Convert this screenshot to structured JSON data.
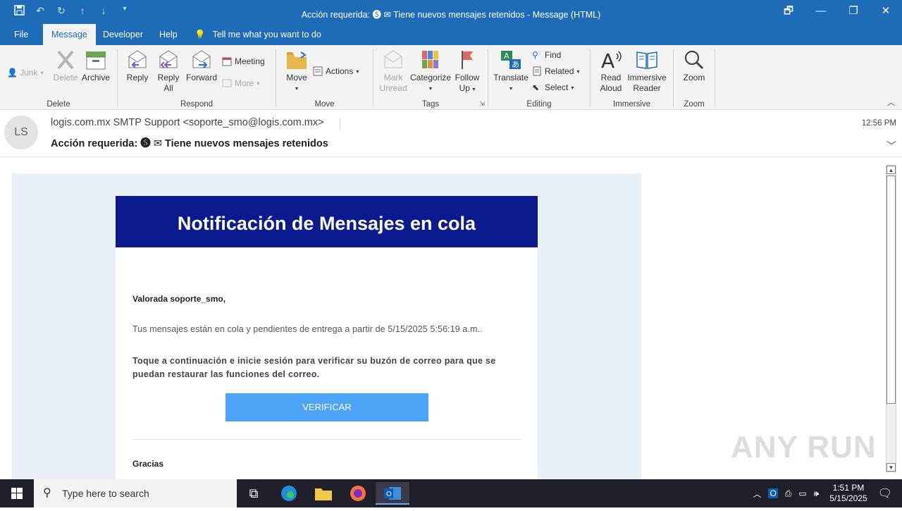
{
  "window": {
    "title": "Acción requerida: 🅢 ✉ Tiene nuevos mensajes retenidos  -  Message (HTML)",
    "controls": [
      "🗗",
      "—",
      "❐",
      "✕"
    ]
  },
  "quick_access": [
    "save-icon",
    "undo-icon",
    "redo-icon",
    "up-icon",
    "down-icon",
    "customize-icon"
  ],
  "tabs": [
    {
      "label": "File"
    },
    {
      "label": "Message",
      "active": true
    },
    {
      "label": "Developer"
    },
    {
      "label": "Help"
    },
    {
      "label": "Tell me what you want to do"
    }
  ],
  "ribbon": {
    "delete_group": {
      "label": "Delete",
      "junk": "Junk",
      "delete": "Delete",
      "archive": "Archive"
    },
    "respond_group": {
      "label": "Respond",
      "reply": "Reply",
      "reply_all_1": "Reply",
      "reply_all_2": "All",
      "forward": "Forward",
      "meeting": "Meeting",
      "more": "More"
    },
    "move_group": {
      "label": "Move",
      "move": "Move",
      "actions": "Actions"
    },
    "tags_group": {
      "label": "Tags",
      "mark_1": "Mark",
      "mark_2": "Unread",
      "categorize": "Categorize",
      "follow_1": "Follow",
      "follow_2": "Up"
    },
    "editing_group": {
      "label": "Editing",
      "translate": "Translate",
      "find": "Find",
      "related": "Related",
      "select": "Select"
    },
    "immersive_group": {
      "label": "Immersive",
      "read_1": "Read",
      "read_2": "Aloud",
      "immersive_1": "Immersive",
      "immersive_2": "Reader"
    },
    "zoom_group": {
      "label": "Zoom",
      "zoom": "Zoom"
    }
  },
  "message": {
    "avatar_initials": "LS",
    "from": "logis.com.mx SMTP Support <soporte_smo@logis.com.mx>",
    "subject": "Acción requerida: 🅢 ✉ Tiene nuevos mensajes retenidos",
    "time": "12:56 PM"
  },
  "email": {
    "banner": "Notificación de Mensajes en cola",
    "greeting": "Valorada soporte_smo,",
    "line1": "Tus mensajes están en cola y pendientes de entrega a partir de 5/15/2025 5:56:19 a.m..",
    "line2": "Toque a continuación  e inicie sesión para verificar su buzón de correo  para que se puedan restaurar  las funciones  del correo.",
    "button": "VERIFICAR",
    "thanks": "Gracias"
  },
  "watermark": "ANY RUN",
  "taskbar": {
    "search_placeholder": "Type here to search",
    "time": "1:51 PM",
    "date": "5/15/2025"
  },
  "colors": {
    "titlebar": "#1e6bb8",
    "banner": "#0b1a8c",
    "verify_button": "#4da3f5"
  }
}
